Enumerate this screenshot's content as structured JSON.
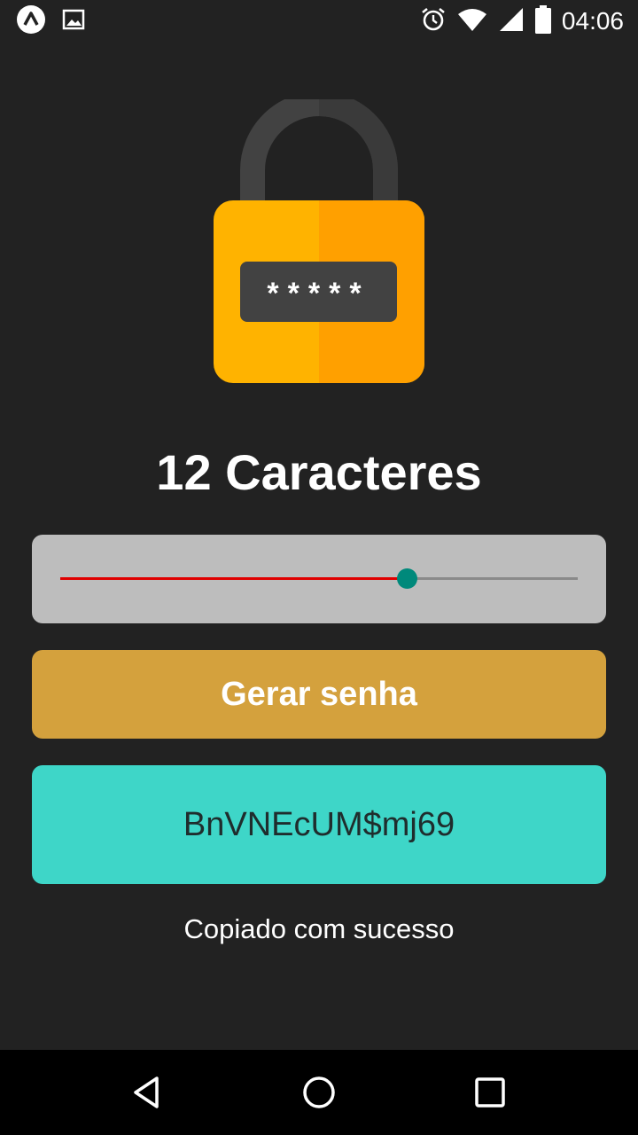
{
  "status_bar": {
    "time": "04:06",
    "left_icons": [
      "expo-icon",
      "image-icon"
    ],
    "right_icons": [
      "alarm-icon",
      "wifi-icon",
      "signal-icon",
      "battery-icon"
    ]
  },
  "lock_illustration": {
    "icon": "padlock-icon",
    "masked_text": "*****",
    "colors": {
      "body": "#ffb300",
      "body_shade": "#ffa000",
      "shackle": "#424242",
      "screen": "#424242"
    }
  },
  "title": "12 Caracteres",
  "slider": {
    "value_fraction": 0.67,
    "colors": {
      "filled": "#e00000",
      "track": "#8a8a8a",
      "thumb": "#00897b",
      "background": "#bdbdbd"
    }
  },
  "generate_button": {
    "label": "Gerar senha",
    "color": "#d4a13d"
  },
  "password": {
    "value": "BnVNEcUM$mj69",
    "background": "#3ed6c8"
  },
  "copy_message": "Copiado com sucesso",
  "nav_bar": {
    "buttons": [
      "back-icon",
      "home-icon",
      "recents-icon"
    ]
  }
}
